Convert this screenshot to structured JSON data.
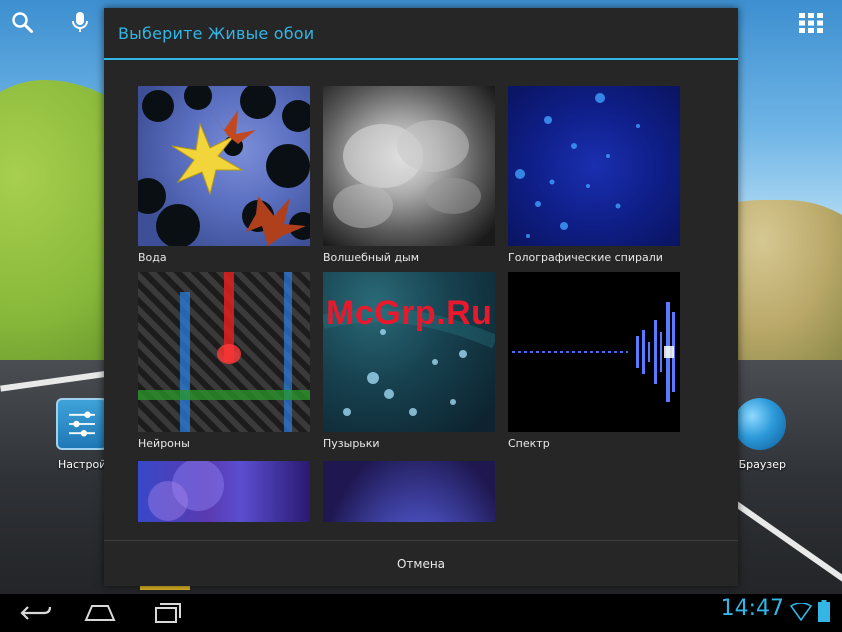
{
  "dialog": {
    "title": "Выберите Живые обои",
    "cancel_label": "Отмена"
  },
  "wallpapers": [
    {
      "label": "Вода",
      "thumb": "water"
    },
    {
      "label": "Волшебный дым",
      "thumb": "smoke"
    },
    {
      "label": "Голографические спирали",
      "thumb": "holo"
    },
    {
      "label": "Нейроны",
      "thumb": "neurons"
    },
    {
      "label": "Пузырьки",
      "thumb": "bubbles"
    },
    {
      "label": "Спектр",
      "thumb": "spectrum"
    },
    {
      "label": "",
      "thumb": "nebula"
    },
    {
      "label": "",
      "thumb": "galaxy"
    }
  ],
  "desktop": {
    "settings_label": "Настройки",
    "browser_label": "Браузер"
  },
  "statusbar": {
    "time": "14:47"
  },
  "watermark": "McGrp.Ru",
  "colors": {
    "accent": "#33b5e5",
    "dialog_bg": "#262626",
    "watermark": "#e8192c"
  },
  "icons": {
    "top_left": [
      "search-icon",
      "mic-icon"
    ],
    "top_right": "apps-grid-icon",
    "nav": [
      "back-icon",
      "home-icon",
      "recent-apps-icon"
    ],
    "status": [
      "wifi-icon",
      "battery-icon"
    ]
  }
}
